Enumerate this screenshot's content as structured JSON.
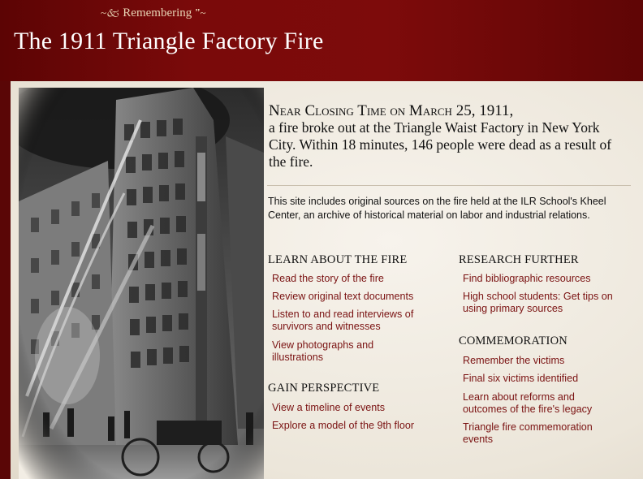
{
  "header": {
    "kicker": "Remembering",
    "kicker_ornament_left": "⸎",
    "kicker_ornament_right": "⸎",
    "title": "The 1911 Triangle Factory Fire"
  },
  "intro": {
    "lead": "Near Closing Time on March 25, 1911,",
    "body": "a fire broke out at the Triangle Waist Factory in New York City. Within 18 minutes, 146 people were dead as a result of the fire."
  },
  "about": "This site includes original sources on the fire held at the ILR School's Kheel Center, an archive of historical material on labor and industrial relations.",
  "sections": {
    "learn": {
      "heading": "LEARN ABOUT THE FIRE",
      "links": [
        "Read the story of the fire",
        "Review original text documents",
        "Listen to and read interviews of survivors and witnesses",
        "View photographs and illustrations"
      ]
    },
    "perspective": {
      "heading": "GAIN PERSPECTIVE",
      "links": [
        "View a timeline of events",
        "Explore a model of the 9th floor"
      ]
    },
    "research": {
      "heading": "RESEARCH FURTHER",
      "links": [
        "Find bibliographic resources",
        "High school students: Get tips on using primary sources"
      ]
    },
    "commemoration": {
      "heading": "COMMEMORATION",
      "links": [
        "Remember the victims",
        "Final six victims identified",
        "Learn about reforms and outcomes of the fire's legacy",
        "Triangle fire commemoration events"
      ]
    }
  },
  "colors": {
    "header_red": "#7a0a0a",
    "panel_bg": "#f2ede4",
    "link": "#7a1212"
  }
}
